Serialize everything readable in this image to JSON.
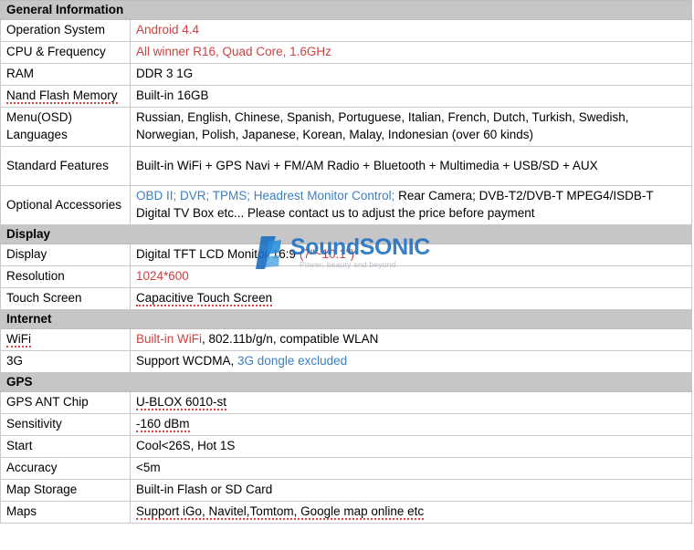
{
  "watermark": {
    "brand": "SoundSONIC",
    "tagline": "Power, beauty and beyond.",
    "brand_color": "#1b6ec2"
  },
  "colors": {
    "section_header_bg": "#c6c6c8",
    "highlight_red": "#cf4141",
    "highlight_blue": "#3a7fc0",
    "border": "#c9c9c9"
  },
  "sections": [
    {
      "title": "General Information",
      "rows": [
        {
          "label": "Operation System",
          "value_red": "Android 4.4"
        },
        {
          "label": "CPU & Frequency",
          "value_red": "All winner R16, Quad Core, 1.6GHz"
        },
        {
          "label": "RAM",
          "value": "DDR 3 1G"
        },
        {
          "label": "Nand Flash Memory",
          "value": "Built-in 16GB"
        },
        {
          "label_line1": "Menu(OSD)",
          "label_line2": "Languages",
          "value_line1": "Russian, English, Chinese, Spanish, Portuguese, Italian, French, Dutch, Turkish, Swedish,",
          "value_line2": "Norwegian, Polish, Japanese, Korean, Malay, Indonesian (over 60 kinds)"
        },
        {
          "label": "Standard Features",
          "value": "Built-in WiFi + GPS Navi + FM/AM Radio + Bluetooth + Multimedia + USB/SD + AUX"
        },
        {
          "label": "Optional Accessories",
          "value_blue": "OBD II; DVR; TPMS; Headrest Monitor Control;",
          "value_black": "Rear Camera; DVB-T2/DVB-T MPEG4/ISDB-T",
          "value_line2": "Digital TV Box etc... Please contact us to adjust the price before payment"
        }
      ]
    },
    {
      "title": "Display",
      "rows": [
        {
          "label": "Display",
          "value_black": "Digital TFT LCD Monitor 16:9",
          "value_red": "(7\"~10.1\")"
        },
        {
          "label": "Resolution",
          "value_red": "1024*600"
        },
        {
          "label": "Touch Screen",
          "value": "Capacitive Touch Screen"
        }
      ]
    },
    {
      "title": "Internet",
      "rows": [
        {
          "label": "WiFi",
          "value_red": "Built-in WiFi",
          "value_black": ", 802.11b/g/n, compatible WLAN"
        },
        {
          "label": "3G",
          "value_black": "Support WCDMA,",
          "value_blue": "3G dongle excluded"
        }
      ]
    },
    {
      "title": "GPS",
      "rows": [
        {
          "label": "GPS ANT Chip",
          "value": "U-BLOX 6010-st"
        },
        {
          "label": "Sensitivity",
          "value": "-160 dBm"
        },
        {
          "label": "Start",
          "value": "Cool<26S, Hot 1S"
        },
        {
          "label": "Accuracy",
          "value": "<5m"
        },
        {
          "label": "Map Storage",
          "value": "Built-in Flash or SD Card"
        },
        {
          "label": "Maps",
          "value": "Support iGo, Navitel,Tomtom, Google map online etc"
        }
      ]
    }
  ]
}
